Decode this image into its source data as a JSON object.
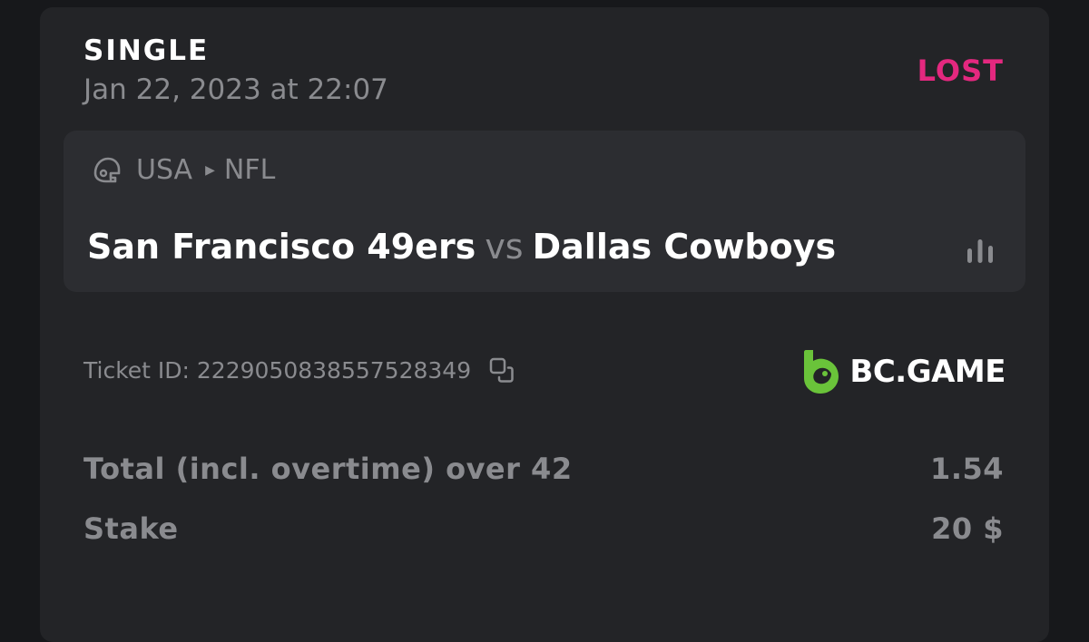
{
  "bet": {
    "type": "SINGLE",
    "date": "Jan 22, 2023 at 22:07",
    "status": "LOST",
    "status_color": "#e4287f"
  },
  "event": {
    "sport_icon": "football-helmet-icon",
    "country": "USA",
    "league": "NFL",
    "home_team": "San Francisco 49ers",
    "vs_label": "vs",
    "away_team": "Dallas Cowboys",
    "stats_icon": "bar-chart-icon"
  },
  "ticket": {
    "label": "Ticket ID: 2229050838557528349",
    "copy_icon": "copy-icon"
  },
  "brand": {
    "name": "BC.GAME",
    "logo_color": "#6ac33a"
  },
  "details": {
    "market": "Total (incl. overtime) over 42",
    "odds": "1.54",
    "stake_label": "Stake",
    "stake_value": "20 $"
  }
}
